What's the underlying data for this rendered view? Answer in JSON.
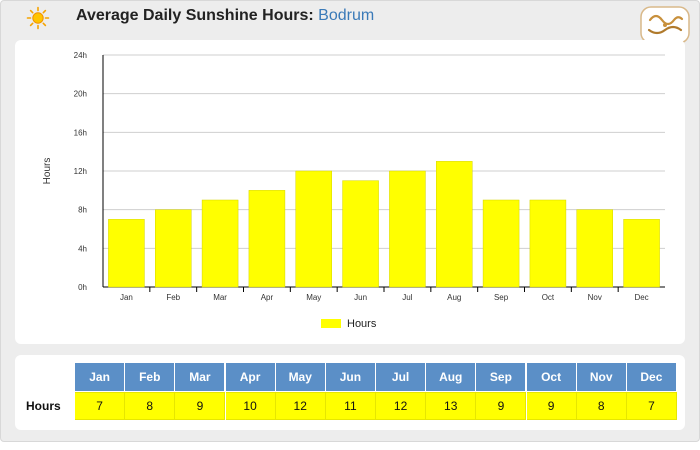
{
  "header": {
    "title_prefix": "Average Daily Sunshine Hours:",
    "city": "Bodrum"
  },
  "colors": {
    "bar": "#ffff00",
    "bar_stroke": "#d4d400",
    "table_header": "#5b8fc7"
  },
  "chart_data": {
    "type": "bar",
    "categories": [
      "Jan",
      "Feb",
      "Mar",
      "Apr",
      "May",
      "Jun",
      "Jul",
      "Aug",
      "Sep",
      "Oct",
      "Nov",
      "Dec"
    ],
    "series": [
      {
        "name": "Hours",
        "values": [
          7,
          8,
          9,
          10,
          12,
          11,
          12,
          13,
          9,
          9,
          8,
          7
        ]
      }
    ],
    "ylabel": "Hours",
    "ylim": [
      0,
      24
    ],
    "yticks": [
      "0h",
      "4h",
      "8h",
      "12h",
      "16h",
      "20h",
      "24h"
    ],
    "grid": true,
    "legend": "bottom-center"
  },
  "table": {
    "row_label": "Hours",
    "months": [
      "Jan",
      "Feb",
      "Mar",
      "Apr",
      "May",
      "Jun",
      "Jul",
      "Aug",
      "Sep",
      "Oct",
      "Nov",
      "Dec"
    ],
    "values": [
      "7",
      "8",
      "9",
      "10",
      "12",
      "11",
      "12",
      "13",
      "9",
      "9",
      "8",
      "7"
    ]
  }
}
